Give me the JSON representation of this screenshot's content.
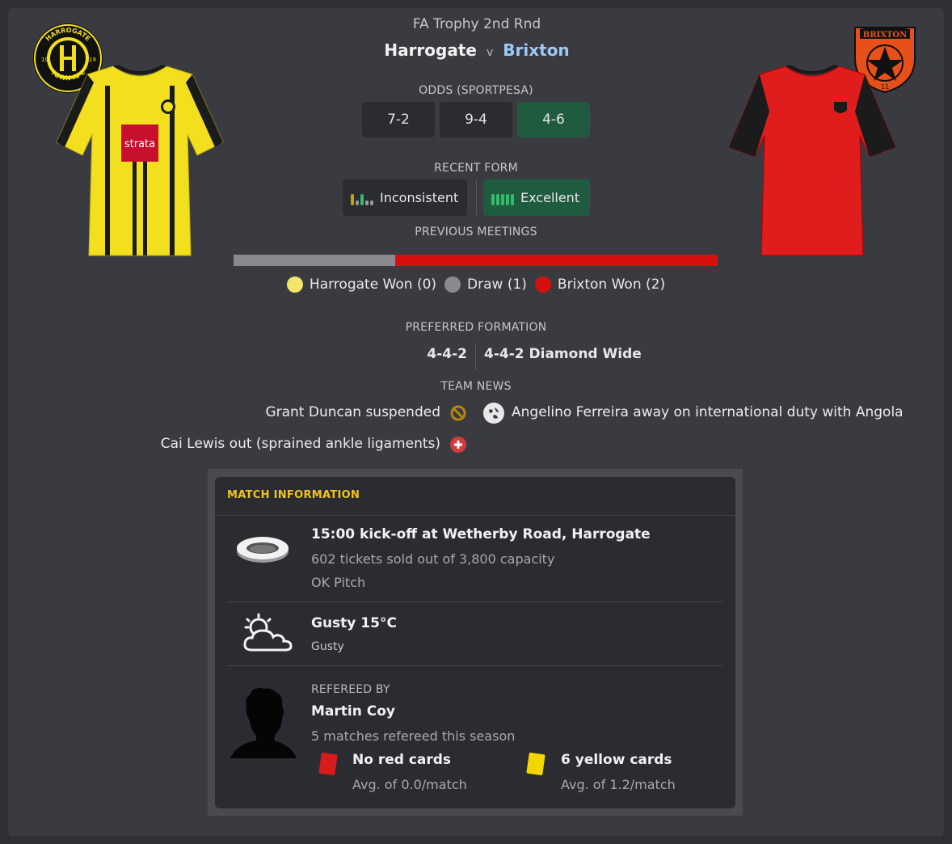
{
  "match": {
    "competition": "FA Trophy 2nd Rnd",
    "home_team": "Harrogate",
    "vs": "v",
    "away_team": "Brixton"
  },
  "odds": {
    "label": "ODDS (SPORTPESA)",
    "home": "7-2",
    "draw": "9-4",
    "away": "4-6"
  },
  "form": {
    "label": "RECENT FORM",
    "home": "Inconsistent",
    "away": "Excellent"
  },
  "meetings": {
    "label": "PREVIOUS MEETINGS",
    "home_won": "Harrogate Won (0)",
    "draw": "Draw (1)",
    "away_won": "Brixton Won (2)",
    "counts": {
      "home": 0,
      "draw": 1,
      "away": 2
    },
    "colors": {
      "home": "#f3e46a",
      "draw": "#8a8a8e",
      "away": "#d80f0f"
    }
  },
  "formation": {
    "label": "PREFERRED FORMATION",
    "home": "4-4-2",
    "away": "4-4-2 Diamond Wide"
  },
  "team_news": {
    "label": "TEAM NEWS",
    "home_items": [
      {
        "text": "Grant Duncan suspended",
        "icon": "suspended-icon"
      },
      {
        "text": "Cai Lewis out (sprained ankle ligaments)",
        "icon": "injury-icon"
      }
    ],
    "away_items": [
      {
        "text": "Angelino Ferreira away on international duty with Angola",
        "icon": "globe-icon"
      }
    ]
  },
  "badges": {
    "home_text_top": "HARROGATE",
    "home_text_bottom": "TOWN AFC",
    "home_year_left": "19",
    "home_year_right": "19",
    "away_text": "BRIXTON",
    "away_number": "11"
  },
  "kits": {
    "home_sponsor": "strata",
    "home_colors": {
      "primary": "#f2df1e",
      "secondary": "#1b1b1b"
    },
    "away_colors": {
      "primary": "#e01d1d",
      "secondary": "#1b1b1b"
    }
  },
  "match_info": {
    "title": "MATCH INFORMATION",
    "venue": {
      "headline": "15:00 kick-off at Wetherby Road, Harrogate",
      "tickets": "602 tickets sold out of 3,800 capacity",
      "pitch": "OK Pitch"
    },
    "weather": {
      "headline": "Gusty 15°C",
      "detail": "Gusty"
    },
    "referee": {
      "label": "REFEREED BY",
      "name": "Martin Coy",
      "matches": "5 matches refereed this season",
      "red_cards": "No red cards",
      "red_avg": "Avg. of 0.0/match",
      "yellow_cards": "6 yellow cards",
      "yellow_avg": "Avg. of 1.2/match"
    }
  }
}
